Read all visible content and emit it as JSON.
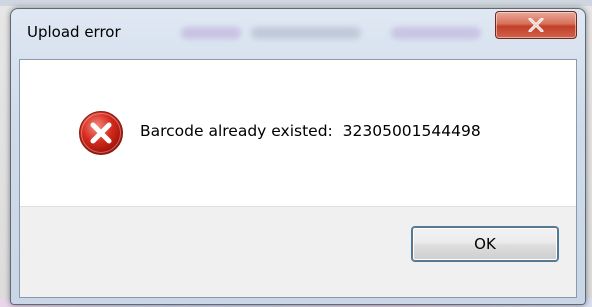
{
  "dialog": {
    "title": "Upload error",
    "close_glyph": "x",
    "icon": "error-icon",
    "message_label": "Barcode already existed:",
    "message_value": "32305001544498",
    "ok_label": "OK"
  },
  "colors": {
    "close_button": "#c2402a",
    "error_icon": "#d42a1d",
    "button_area": "#f0f0f0",
    "frame": "#cfdbe9"
  }
}
